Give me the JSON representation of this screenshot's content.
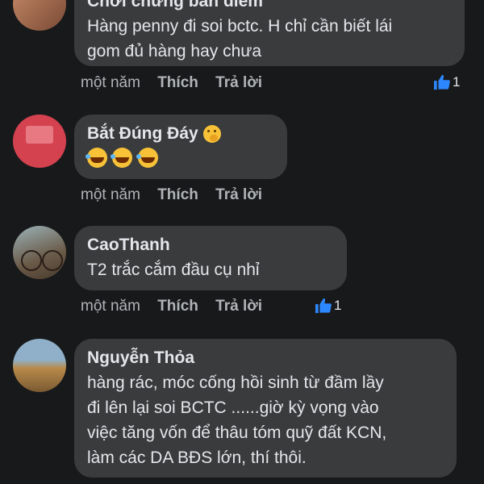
{
  "comments": [
    {
      "author": "Chơi chứng bán điếm",
      "lines": [
        "Hàng penny đi soi bctc. H chỉ cần biết lái",
        "gom đủ hàng hay chưa"
      ],
      "time": "một năm",
      "like_label": "Thích",
      "reply_label": "Trả lời",
      "reactions": "1"
    },
    {
      "author": "Bắt Đúng Đáy",
      "author_emoji": "hand-over-mouth-emoji",
      "lines": [],
      "emoji_line": [
        "rofl-emoji",
        "rofl-emoji",
        "rofl-emoji"
      ],
      "time": "một năm",
      "like_label": "Thích",
      "reply_label": "Trả lời"
    },
    {
      "author": "CaoThanh",
      "lines": [
        "T2 trắc cắm đầu cụ nhỉ"
      ],
      "time": "một năm",
      "like_label": "Thích",
      "reply_label": "Trả lời",
      "reactions": "1"
    },
    {
      "author": "Nguyễn Thỏa",
      "lines": [
        "hàng rác, móc cống hồi sinh từ đầm lầy",
        "đi lên lại soi BCTC ......giờ kỳ vọng vào",
        "việc tăng vốn để thâu tóm quỹ đất KCN,",
        "làm các DA BĐS lớn, thí thôi."
      ]
    }
  ],
  "colors": {
    "background": "#18191a",
    "bubble": "#3a3b3c",
    "text": "#e4e6eb",
    "muted": "#b0b3b8",
    "like_blue": "#2d88ff"
  }
}
